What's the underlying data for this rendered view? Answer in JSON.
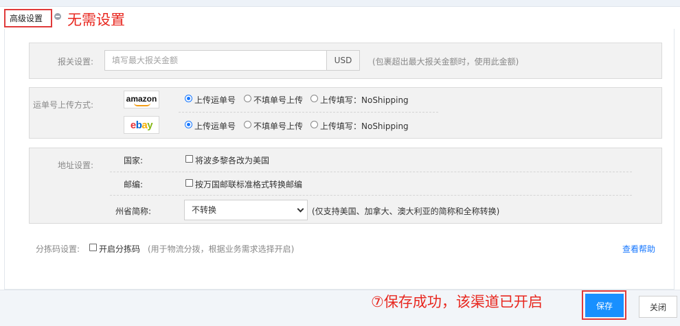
{
  "tab": {
    "label": "高级设置",
    "annotation": "无需设置"
  },
  "customs": {
    "label": "报关设置:",
    "input_placeholder": "填写最大报关金额",
    "input_value": "",
    "currency": "USD",
    "hint": "(包裹超出最大报关金额时，使用此金额)"
  },
  "tracking": {
    "label": "运单号上传方式:",
    "rows": [
      {
        "platform_icon": "amazon-logo",
        "options": [
          "上传运单号",
          "不填单号上传",
          "上传填写：NoShipping"
        ],
        "selected": 0
      },
      {
        "platform_icon": "ebay-logo",
        "options": [
          "上传运单号",
          "不填单号上传",
          "上传填写：NoShipping"
        ],
        "selected": 0
      }
    ],
    "amazon_text": "amazon",
    "ebay_letters": [
      "e",
      "b",
      "a",
      "y"
    ]
  },
  "address": {
    "label": "地址设置:",
    "country_label": "国家:",
    "country_option": "将波多黎各改为美国",
    "zip_label": "邮编:",
    "zip_option": "按万国邮联标准格式转换邮编",
    "state_label": "州省简称:",
    "state_value": "不转换",
    "state_hint": "(仅支持美国、加拿大、澳大利亚的简称和全称转换)"
  },
  "sorting": {
    "label": "分拣码设置:",
    "checkbox_label": "开启分拣码",
    "hint": "(用于物流分拨，根据业务需求选择开启)",
    "help_link": "查看帮助"
  },
  "footer": {
    "annotation": "⑦保存成功，该渠道已开启",
    "save_label": "保存",
    "close_label": "关闭"
  },
  "colors": {
    "accent": "#1890ff",
    "annotation_red": "#e8271f",
    "link": "#1677ff"
  }
}
